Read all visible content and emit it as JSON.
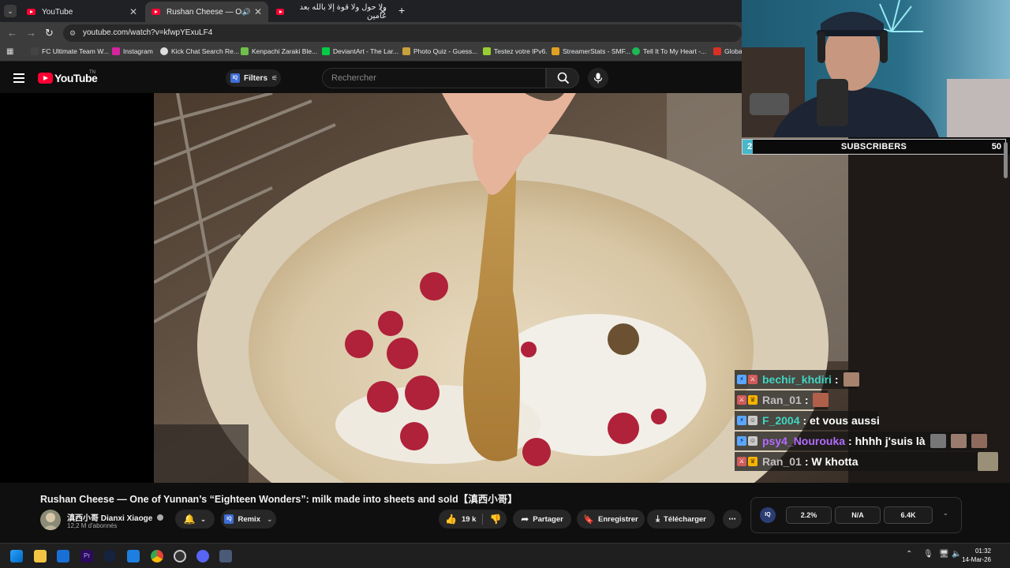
{
  "browser": {
    "tabs": [
      {
        "label": "YouTube",
        "active": false
      },
      {
        "label": "Rushan Cheese — One of Y",
        "active": true
      },
      {
        "label": "ولا حول ولا قوة إلا بالله بعد عامين",
        "active": false
      }
    ],
    "url": "youtube.com/watch?v=kfwpYExuLF4",
    "bookmarks": [
      {
        "label": "FC Ultimate Team W...",
        "color": "#444444"
      },
      {
        "label": "Instagram",
        "color": "#d6249f"
      },
      {
        "label": "Kick Chat Search Re...",
        "color": "#dddddd"
      },
      {
        "label": "Kenpachi Zaraki Ble...",
        "color": "#6ec04a"
      },
      {
        "label": "DeviantArt - The Lar...",
        "color": "#05cc47"
      },
      {
        "label": "Photo Quiz - Guess...",
        "color": "#c9a23a"
      },
      {
        "label": "Testez votre IPv6.",
        "color": "#9acd32"
      },
      {
        "label": "StreamerStats - SMF...",
        "color": "#e0a020"
      },
      {
        "label": "Tell It To My Heart -...",
        "color": "#1db954"
      },
      {
        "label": "Globa",
        "color": "#d93025"
      }
    ]
  },
  "youtube": {
    "logo_text": "YouTube",
    "logo_superscript": "TN",
    "filters_label": "Filters",
    "search_placeholder": "Rechercher"
  },
  "stream_overlay": {
    "subscriber_current": "2",
    "subscriber_label": "SUBSCRIBERS",
    "subscriber_goal": "50",
    "subscriber_progress": 0.04,
    "chat": [
      {
        "user": "bechir_khdiri",
        "user_color": "#3fd6c3",
        "message": "",
        "badges": [
          "prime",
          "mod"
        ],
        "emotes": 1
      },
      {
        "user": "Ran_01",
        "user_color": "#bfbfbf",
        "message": "",
        "badges": [
          "mod",
          "crown"
        ],
        "emotes": 1
      },
      {
        "user": "F_2004",
        "user_color": "#3fd6c3",
        "message": "et vous aussi",
        "badges": [
          "prime",
          "sub"
        ],
        "emotes": 0
      },
      {
        "user": "psy4_Nourouka",
        "user_color": "#b36bff",
        "message": "hhhh j'suis là",
        "badges": [
          "prime",
          "sub"
        ],
        "emotes": 3
      },
      {
        "user": "Ran_01",
        "user_color": "#bfbfbf",
        "message": "W khotta",
        "badges": [
          "mod",
          "crown"
        ],
        "emotes": 1
      }
    ]
  },
  "video": {
    "title": "Rushan Cheese — One of Yunnan’s “Eighteen Wonders”: milk made into sheets and sold【滇西小哥】",
    "channel_name": "滇西小哥 Dianxi Xiaoge",
    "subscribers": "12,2 M d'abonnés",
    "remix_label": "Remix",
    "likes": "19 k",
    "share_label": "Partager",
    "save_label": "Enregistrer",
    "download_label": "Télécharger"
  },
  "iq_panel": {
    "stats": [
      "2.2%",
      "N/A",
      "6.4K"
    ]
  },
  "taskbar": {
    "time": "01:32",
    "date": "14-Mar-26"
  }
}
